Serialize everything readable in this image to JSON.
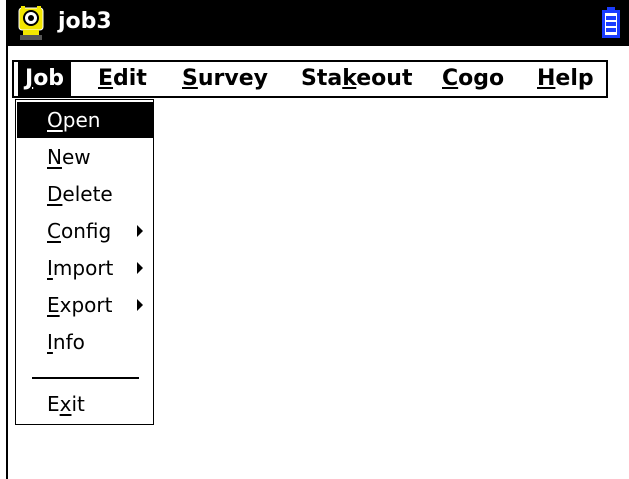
{
  "title": {
    "text": "job3"
  },
  "menubar": {
    "items": [
      {
        "key": "J",
        "rest": "ob"
      },
      {
        "key": "E",
        "rest": "dit"
      },
      {
        "key": "S",
        "rest": "urvey"
      },
      {
        "pre": "Sta",
        "key": "k",
        "rest": "eout"
      },
      {
        "key": "C",
        "rest": "ogo"
      },
      {
        "key": "H",
        "rest": "elp"
      }
    ]
  },
  "dropdown": {
    "items": [
      {
        "key": "O",
        "rest": "pen"
      },
      {
        "key": "N",
        "rest": "ew"
      },
      {
        "key": "D",
        "rest": "elete"
      },
      {
        "key": "C",
        "rest": "onfig"
      },
      {
        "key": "I",
        "rest": "mport"
      },
      {
        "key": "E",
        "rest": "xport"
      },
      {
        "key": "I",
        "rest": "nfo"
      },
      {
        "pre": "E",
        "key": "x",
        "rest": "it"
      }
    ]
  },
  "colors": {
    "titlebar": "#000000",
    "selection": "#000000",
    "icon_yellow": "#f2e600",
    "battery": "#1a3cff"
  }
}
